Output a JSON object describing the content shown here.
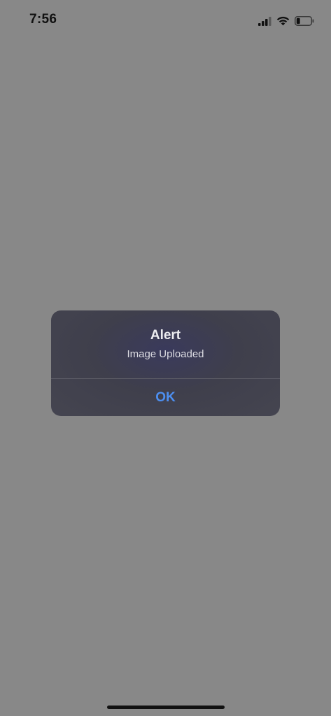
{
  "status_bar": {
    "time": "7:56",
    "icons": [
      "cellular-signal-icon",
      "wifi-icon",
      "battery-icon"
    ],
    "battery_level": 0.25
  },
  "alert": {
    "title": "Alert",
    "message": "Image Uploaded",
    "button_label": "OK"
  },
  "colors": {
    "background_dim": "#888888",
    "dialog_background": "#434350",
    "button_accent": "#4d8ff0"
  }
}
